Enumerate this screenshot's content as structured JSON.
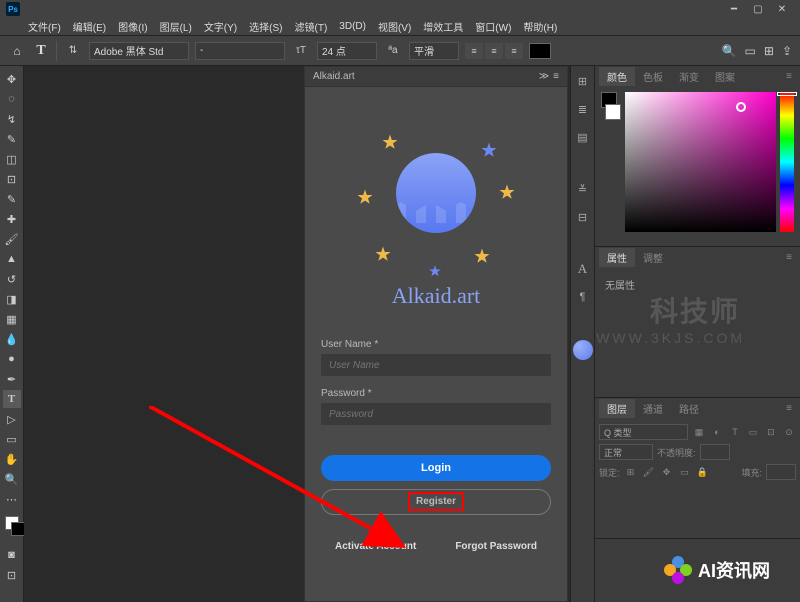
{
  "menus": [
    "文件(F)",
    "编辑(E)",
    "图像(I)",
    "图层(L)",
    "文字(Y)",
    "选择(S)",
    "滤镜(T)",
    "3D(D)",
    "视图(V)",
    "增效工具",
    "窗口(W)",
    "帮助(H)"
  ],
  "options": {
    "font_family": "Adobe 黑体 Std",
    "font_style": "-",
    "font_size": "24 点",
    "aa_label": "平滑"
  },
  "plugin": {
    "title": "Alkaid.art",
    "brand": "Alkaid.art",
    "username_label": "User Name *",
    "username_placeholder": "User Name",
    "password_label": "Password *",
    "password_placeholder": "Password",
    "login_btn": "Login",
    "register_btn": "Register",
    "activate_link": "Activate Account",
    "forgot_link": "Forgot Password"
  },
  "tabs": {
    "color": [
      "颜色",
      "色板",
      "渐变",
      "图案"
    ],
    "props": [
      "属性",
      "调整"
    ],
    "layers": [
      "图层",
      "通道",
      "路径"
    ]
  },
  "props": {
    "no_props": "无属性"
  },
  "layers": {
    "type": "Q 类型",
    "mode": "正常",
    "opacity_label": "不透明度:",
    "lock_label": "锁定:",
    "fill_label": "填充:"
  },
  "watermark1": "科技师",
  "watermark1b": "WWW.3KJS.COM",
  "watermark2": "AI资讯网"
}
